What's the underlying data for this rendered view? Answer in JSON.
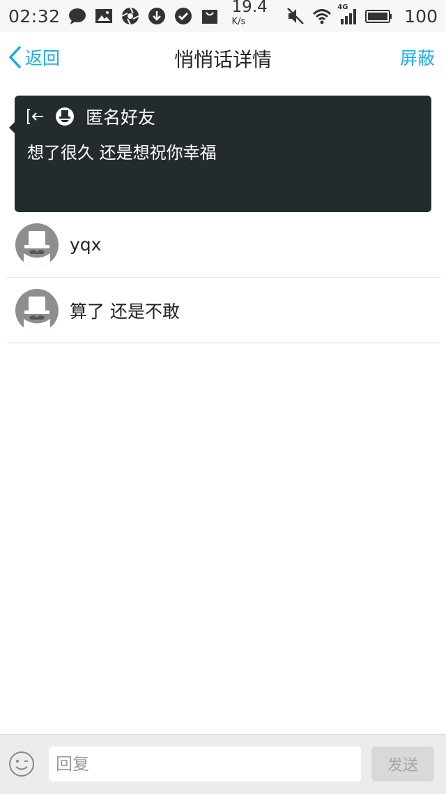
{
  "status_bar": {
    "time": "02:32",
    "speed_value": "19.4",
    "speed_unit": "K/s",
    "network_type": "4G",
    "battery": "100",
    "icons": [
      "message-icon",
      "gallery-icon",
      "aperture-icon",
      "download-icon",
      "check-icon",
      "bag-icon",
      "mute-icon",
      "wifi-icon",
      "signal-icon",
      "battery-icon"
    ]
  },
  "nav": {
    "back_label": "返回",
    "title": "悄悄话详情",
    "block_label": "屏蔽"
  },
  "message": {
    "sender": "匿名好友",
    "text": "想了很久 还是想祝你幸福"
  },
  "replies": [
    {
      "text": "yqx"
    },
    {
      "text": "算了 还是不敢"
    }
  ],
  "composer": {
    "placeholder": "回复",
    "send_label": "发送"
  },
  "colors": {
    "accent": "#1aaee7",
    "card_bg": "#232b2e",
    "avatar_bg": "#8e8e8e"
  }
}
